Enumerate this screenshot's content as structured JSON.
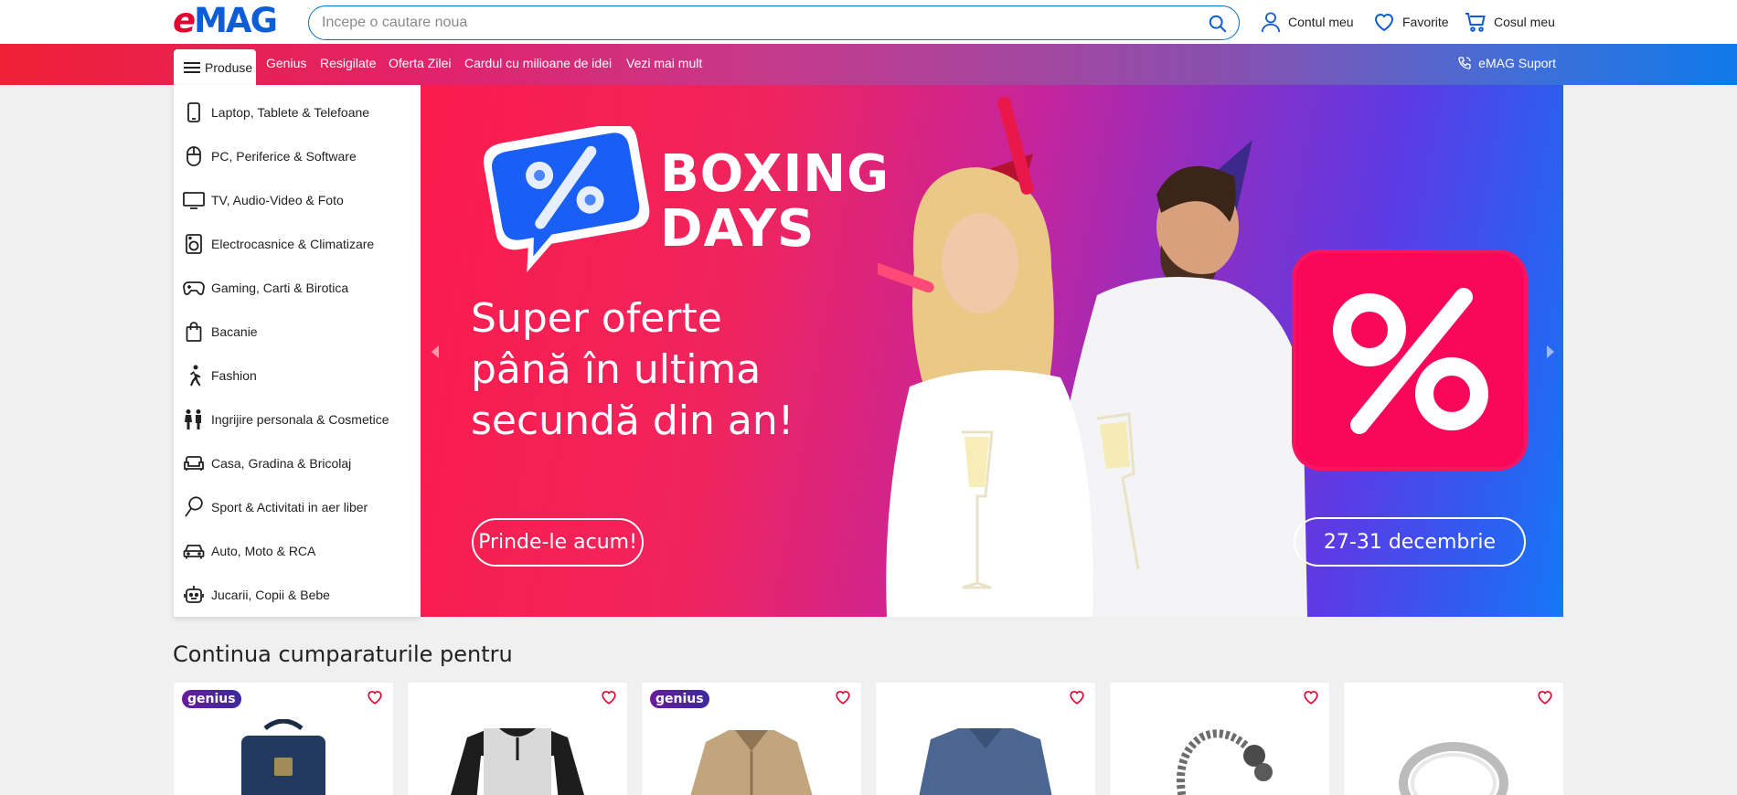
{
  "header": {
    "logo": "eMAG",
    "search_placeholder": "Incepe o cautare noua",
    "account_label": "Contul meu",
    "favorites_label": "Favorite",
    "cart_label": "Cosul meu"
  },
  "nav": {
    "produse": "Produse",
    "items": [
      "Genius",
      "Resigilate",
      "Oferta Zilei",
      "Cardul cu milioane de idei",
      "Vezi mai mult"
    ],
    "support": "eMAG Suport"
  },
  "categories": [
    {
      "label": "Laptop, Tablete & Telefoane",
      "icon": "phone-icon"
    },
    {
      "label": "PC, Periferice & Software",
      "icon": "mouse-icon"
    },
    {
      "label": "TV, Audio-Video & Foto",
      "icon": "tv-icon"
    },
    {
      "label": "Electrocasnice & Climatizare",
      "icon": "washing-machine-icon"
    },
    {
      "label": "Gaming, Carti & Birotica",
      "icon": "gamepad-icon"
    },
    {
      "label": "Bacanie",
      "icon": "shopping-bag-icon"
    },
    {
      "label": "Fashion",
      "icon": "running-person-icon"
    },
    {
      "label": "Ingrijire personala & Cosmetice",
      "icon": "people-icon"
    },
    {
      "label": "Casa, Gradina & Bricolaj",
      "icon": "sofa-icon"
    },
    {
      "label": "Sport & Activitati in aer liber",
      "icon": "racket-icon"
    },
    {
      "label": "Auto, Moto & RCA",
      "icon": "car-icon"
    },
    {
      "label": "Jucarii, Copii & Bebe",
      "icon": "robot-toy-icon"
    }
  ],
  "banner": {
    "title_line1": "BOXING",
    "title_line2": "DAYS",
    "headline": "Super oferte\npână în ultima\nsecundă din an!",
    "cta": "Prinde-le acum!",
    "dates": "27-31 decembrie"
  },
  "continue_section": {
    "title": "Continua cumparaturile pentru",
    "badge_label": "genius",
    "cards": [
      {
        "genius": true,
        "image": "backpack"
      },
      {
        "genius": false,
        "image": "raglan-shirt"
      },
      {
        "genius": true,
        "image": "jacket"
      },
      {
        "genius": false,
        "image": "sweater"
      },
      {
        "genius": false,
        "image": "chain-bracelet"
      },
      {
        "genius": false,
        "image": "ring"
      }
    ]
  },
  "colors": {
    "brand_red": "#e4032e",
    "brand_blue": "#0d5cd8",
    "link_blue": "#0070c9",
    "fav_red": "#e4032e"
  }
}
